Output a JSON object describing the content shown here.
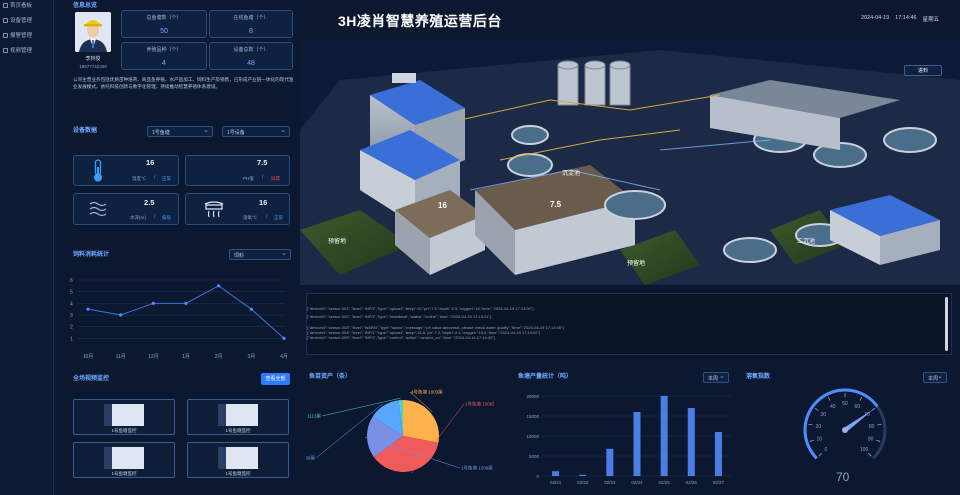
{
  "nav": {
    "items": [
      {
        "label": "首页看板",
        "icon": "monitor-icon"
      },
      {
        "label": "设备管理",
        "icon": "gear-icon"
      },
      {
        "label": "报警管理",
        "icon": "bell-icon"
      },
      {
        "label": "视频管理",
        "icon": "camera-icon"
      }
    ]
  },
  "header": {
    "title": "3H凌肖智慧养殖运营后台",
    "date": "2024-04-19",
    "time": "17:14:46",
    "weekday": "星期五"
  },
  "info": {
    "title": "信息总览",
    "user_name": "李林俊",
    "user_phone": "18977742300",
    "stats": [
      {
        "label": "总鱼塘数（个）",
        "value": "50"
      },
      {
        "label": "在线鱼塘（个）",
        "value": "8"
      },
      {
        "label": "养殖品种（个）",
        "value": "4"
      },
      {
        "label": "设备总数（个）",
        "value": "48"
      }
    ],
    "description": "公司主营业务包括优质苗种培育、商品鱼养殖、水产品加工、饲料生产及销售，已形成产业链一体化的现代渔业发展模式。依托科技创新与数字化管理，持续推动智慧养殖体系建设。"
  },
  "device": {
    "title": "设备数据",
    "pond_select": "1号鱼塘",
    "device_select": "1号设备",
    "readings": [
      {
        "value": "16",
        "label": "温度℃",
        "status": "正常",
        "status_color": "#3aa0ff",
        "icon": "thermometer-icon"
      },
      {
        "value": "7.5",
        "label": "PH值",
        "status": "异常",
        "status_color": "#ff4d4f",
        "icon": "ph-icon"
      },
      {
        "value": "2.5",
        "label": "水深(m)",
        "status": "偏低",
        "status_color": "#3aa0ff",
        "icon": "water-depth-icon"
      },
      {
        "value": "16",
        "label": "溶氧℃",
        "status": "正常",
        "status_color": "#3aa0ff",
        "icon": "oxygen-icon"
      }
    ]
  },
  "feed": {
    "title": "饲料消耗统计",
    "select": "饲料"
  },
  "video": {
    "title": "全场视频监控",
    "button": "查看全部",
    "cams": [
      "1号鱼塘监控",
      "1号鱼塘监控",
      "1号鱼塘监控",
      "1号鱼塘监控"
    ]
  },
  "scene": {
    "top_button": "进料",
    "labels": [
      "沉淀池",
      "预留地",
      "预留地",
      "二沉池"
    ],
    "values": [
      "16",
      "7.5"
    ]
  },
  "log": {
    "lines": [
      "{\"deviceId\":\"sensor-001\",\"level\":\"INFO\",\"type\":\"upload\",\"temp\":16,\"ph\":7.5,\"depth\":2.5,\"oxygen\":16,\"time\":\"2024-04-19 17:13:00\"}",
      "{\"deviceId\":\"sensor-002\",\"level\":\"INFO\",\"type\":\"heartbeat\",\"status\":\"online\",\"time\":\"2024-04-19 17:13:21\"}",
      "{\"deviceId\":\"sensor-003\",\"level\":\"WARN\",\"type\":\"alarm\",\"message\":\"ph value abnormal, please check water quality\",\"time\":\"2024-04-19 17:13:45\"}",
      "{\"deviceId\":\"sensor-004\",\"level\":\"INFO\",\"type\":\"upload\",\"temp\":15.8,\"ph\":7.2,\"depth\":2.4,\"oxygen\":15.6,\"time\":\"2024-04-19 17:14:02\"}",
      "{\"deviceId\":\"sensor-005\",\"level\":\"INFO\",\"type\":\"control\",\"action\":\"aerator_on\",\"time\":\"2024-04-19 17:14:30\"}"
    ]
  },
  "assets": {
    "title": "鱼苗资产（条）"
  },
  "yield": {
    "title": "鱼塘产量统计（吨）",
    "select": "本周"
  },
  "flow": {
    "title": "溶氧指数",
    "select": "本周",
    "value": "70"
  },
  "chart_data": [
    {
      "type": "line",
      "x": [
        "10月",
        "11月",
        "12月",
        "1月",
        "2月",
        "3月",
        "4月"
      ],
      "values": [
        3.5,
        3,
        4,
        4,
        5.5,
        3.5,
        1
      ],
      "ylim": [
        0,
        6
      ],
      "yticks": [
        "1",
        "2",
        "3",
        "4",
        "5",
        "6"
      ]
    },
    {
      "type": "pie",
      "labels": [
        "4号鱼塘 1003尾",
        "1号鱼塘 1508尾",
        "1号鱼塘 1309尾",
        "2号鱼塘 1358尾",
        "3号鱼塘 1113尾"
      ],
      "values": [
        28,
        37,
        19,
        14,
        2
      ],
      "colors": [
        "#ffb14a",
        "#ef5a5a",
        "#7a8fe6",
        "#58a6ff",
        "#4dd2c8"
      ]
    },
    {
      "type": "bar",
      "categories": [
        "02/21",
        "02/22",
        "02/23",
        "02/24",
        "02/25",
        "02/26",
        "02/27"
      ],
      "values": [
        1200,
        300,
        6800,
        16000,
        20000,
        17000,
        11000
      ],
      "ylim": [
        0,
        20000
      ],
      "yticks": [
        "0",
        "5000",
        "10000",
        "15000",
        "20000"
      ]
    },
    {
      "type": "gauge",
      "value": 70,
      "range": [
        0,
        100
      ],
      "ticks": [
        "0",
        "10",
        "20",
        "30",
        "40",
        "50",
        "60",
        "70",
        "80",
        "90",
        "100"
      ]
    }
  ]
}
